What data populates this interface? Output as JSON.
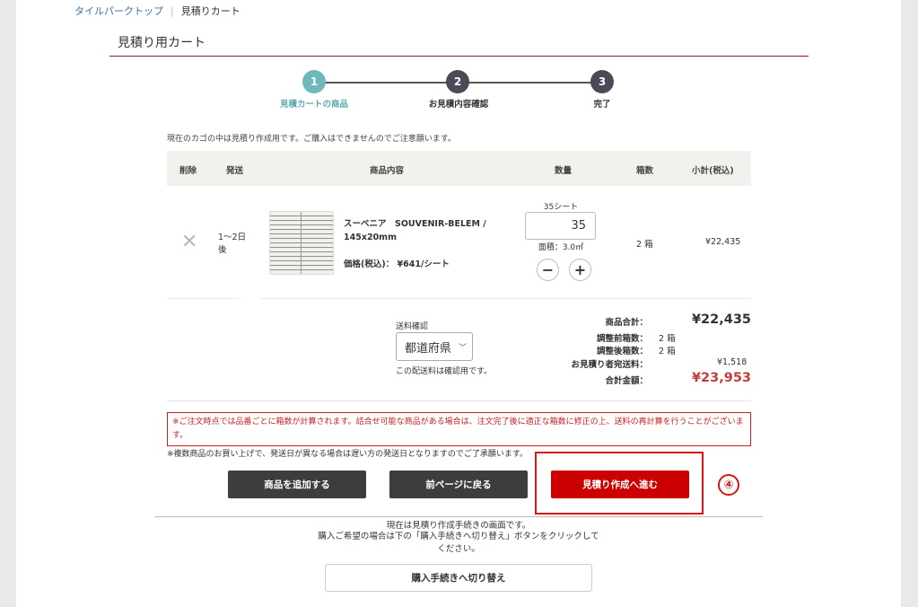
{
  "breadcrumb": {
    "home": "タイルパークトップ",
    "separator": "|",
    "current": "見積りカート"
  },
  "page_title": "見積り用カート",
  "steps": [
    {
      "number": "1",
      "label": "見積カートの商品"
    },
    {
      "number": "2",
      "label": "お見積内容確認"
    },
    {
      "number": "3",
      "label": "完了"
    }
  ],
  "notice": "現在のカゴの中は見積り作成用です。ご購入はできませんのでご注意願います。",
  "table": {
    "headers": {
      "delete": "削除",
      "ship": "発送",
      "item": "商品内容",
      "qty": "数量",
      "boxes": "箱数",
      "subtotal": "小計(税込)"
    },
    "row": {
      "delete_glyph": "✕",
      "ship": "1～2日後",
      "name": "スーベニア　SOUVENIR-BELEM / 145x20mm",
      "price": "価格(税込)： ¥641/シート",
      "qty_caption": "35シート",
      "qty_value": "35",
      "area": "面積：3.0㎡",
      "minus": "−",
      "plus": "+",
      "boxes": "2 箱",
      "subtotal": "¥22,435"
    }
  },
  "shipping": {
    "caption": "送料確認",
    "select_value": "都道府県",
    "note": "この配送料は確認用です。"
  },
  "summary": {
    "goods_total_label": "商品合計：",
    "goods_total": "¥22,435",
    "before_label": "調整前箱数：",
    "before_value": "2 箱",
    "after_label": "調整後箱数：",
    "after_value": "2 箱",
    "ship_label": "お見積り者宛送料：",
    "ship_value": "¥1,518",
    "grand_label": "合計金額：",
    "grand_total": "¥23,953"
  },
  "warning": "※ご注文時点では品番ごとに箱数が計算されます。詰合せ可能な商品がある場合は、注文完了後に適正な箱数に修正の上、送料の再計算を行うことがございます。",
  "sub_note": "※複数商品のお買い上げで、発送日が異なる場合は遅い方の発送日となりますのでご了承願います。",
  "buttons": {
    "add": "商品を追加する",
    "back": "前ページに戻る",
    "proceed": "見積り作成へ進む"
  },
  "annotation": "④",
  "footer": {
    "line1": "現在は見積り作成手続きの画面です。",
    "line2": "購入ご希望の場合は下の「購入手続きへ切り替え」ボタンをクリックしてください。",
    "switch_button": "購入手続きへ切り替え"
  },
  "colors": {
    "accent_teal": "#6fb8ba",
    "step_dark": "#4a4a58",
    "primary_red": "#cc0000",
    "total_red": "#c53c3c"
  }
}
